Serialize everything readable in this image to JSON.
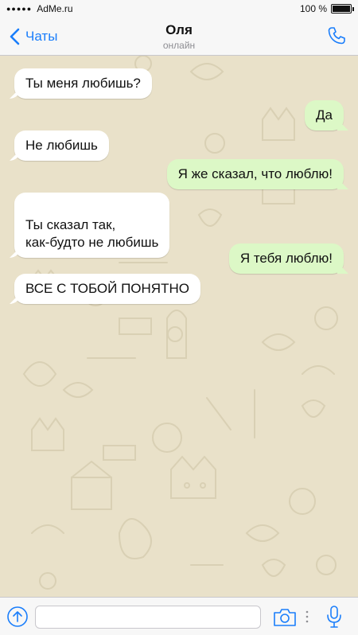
{
  "status_bar": {
    "carrier": "AdMe.ru",
    "battery_text": "100 %",
    "battery_level": 1.0
  },
  "nav": {
    "back_label": "Чаты",
    "contact_name": "Оля",
    "contact_status": "онлайн",
    "back_icon": "chevron-left-icon",
    "call_icon": "phone-icon"
  },
  "messages": [
    {
      "direction": "incoming",
      "text": "Ты меня любишь?"
    },
    {
      "direction": "outgoing",
      "text": "Да"
    },
    {
      "direction": "incoming",
      "text": "Не любишь"
    },
    {
      "direction": "outgoing",
      "text": "Я же сказал, что люблю!"
    },
    {
      "direction": "incoming",
      "text": "Ты сказал так,\nкак-будто не любишь"
    },
    {
      "direction": "outgoing",
      "text": "Я тебя люблю!"
    },
    {
      "direction": "incoming",
      "text": "ВСЕ С ТОБОЙ ПОНЯТНО"
    }
  ],
  "input_bar": {
    "message_value": "",
    "upload_icon": "arrow-up-circle-icon",
    "camera_icon": "camera-icon",
    "mic_icon": "microphone-icon"
  },
  "colors": {
    "accent": "#1a7efb",
    "chat_background": "#e9e1c9",
    "incoming_bubble": "#ffffff",
    "outgoing_bubble": "#dcf8c6"
  }
}
